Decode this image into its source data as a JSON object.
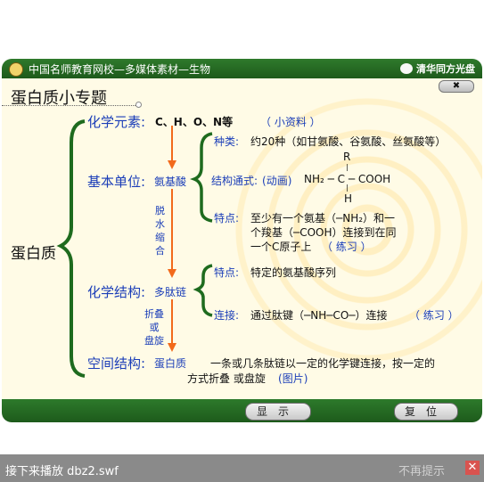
{
  "header": {
    "title": "中国名师教育网校—多媒体素材—生物",
    "brand": "清华同方光盘"
  },
  "lesson": {
    "subtitle": "蛋白质小专题",
    "close_label": "✖",
    "root": "蛋白质",
    "elements": {
      "label": "化学元素:",
      "items": "C、H、O、N等",
      "link": "小资料"
    },
    "basic_unit": {
      "label": "基本单位:",
      "value": "氨基酸",
      "kinds_label": "种类:",
      "kinds_text": "约20种（如甘氨酸、谷氨酸、丝氨酸等）",
      "formula_label": "结构通式:",
      "formula_link": "动画",
      "formula": {
        "top": "R",
        "left": "NH₂ ─ C ─ COOH",
        "bottom": "H"
      },
      "feature_label": "特点:",
      "feature_line1": "至少有一个氨基（─NH₂）和一",
      "feature_line2": "个羧基（─COOH）连接到在同",
      "feature_line3": "一个C原子上",
      "feature_link": "练习"
    },
    "arrow_labels": {
      "first": [
        "脱",
        "水",
        "缩",
        "合"
      ],
      "second": [
        "折叠",
        "或",
        "盘旋"
      ]
    },
    "chem_structure": {
      "label": "化学结构:",
      "value": "多肽链",
      "feature_label": "特点:",
      "feature_text": "特定的氨基酸序列",
      "connect_label": "连接:",
      "connect_text": "通过肽键（─NH─CO─）连接",
      "connect_link": "练习"
    },
    "spatial": {
      "label": "空间结构:",
      "value": "蛋白质",
      "text_line1": "一条或几条肽链以一定的化学键连接，按一定的",
      "text_line2": "方式折叠 或盘旋",
      "link": "图片"
    }
  },
  "controls": {
    "show": "显示",
    "reset": "复位"
  },
  "status": {
    "message": "接下来播放 dbz2.swf",
    "dismiss": "不再提示",
    "close": "✕"
  },
  "colors": {
    "brace_green": "#1e6b1e",
    "arrow_orange": "#f26a1b",
    "text_blue": "#1b3eb8",
    "bar_green": "#2f7a2c"
  }
}
